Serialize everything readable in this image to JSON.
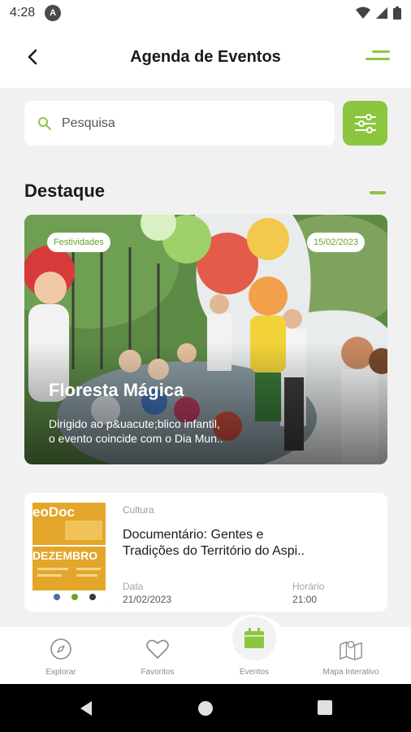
{
  "status_bar": {
    "time": "4:28",
    "app_badge": "A"
  },
  "header": {
    "title": "Agenda de Eventos"
  },
  "search": {
    "placeholder": "Pesquisa"
  },
  "featured": {
    "section_title": "Destaque",
    "category": "Festividades",
    "date": "15/02/2023",
    "title": "Floresta Mágica",
    "description_line1": "Dirigido ao p&uacute;blico infantil,",
    "description_line2": "o evento coincide com o Dia Mun.."
  },
  "event": {
    "category": "Cultura",
    "title_line1": "Documentário: Gentes e",
    "title_line2": "Tradições do Território do Aspi..",
    "thumb_text_top": "eoDoc",
    "thumb_text_month": "DEZEMBRO",
    "date_label": "Data",
    "date_value": "21/02/2023",
    "time_label": "Horário",
    "time_value": "21:00"
  },
  "bottom_nav": {
    "items": [
      {
        "label": "Explorar",
        "icon": "compass-icon"
      },
      {
        "label": "Favoritos",
        "icon": "heart-icon"
      },
      {
        "label": "Eventos",
        "icon": "calendar-icon"
      },
      {
        "label": "Mapa Interativo",
        "icon": "map-icon"
      }
    ],
    "active": "Eventos"
  },
  "colors": {
    "accent": "#8cc63f",
    "background": "#f1f1f1",
    "card": "#ffffff"
  }
}
